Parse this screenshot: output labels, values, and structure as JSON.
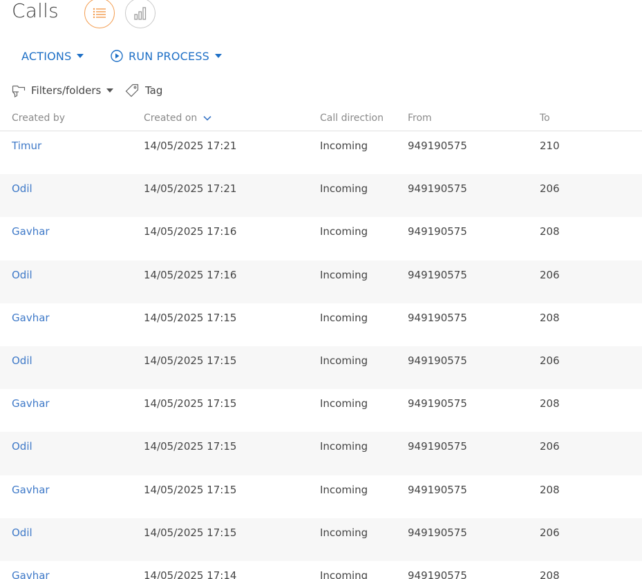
{
  "page": {
    "title": "Calls"
  },
  "colors": {
    "accent_orange": "#f39a4b",
    "link_blue": "#3e79c8",
    "action_blue": "#1d6fc6"
  },
  "view_switch": {
    "list_icon": "list-view-icon",
    "chart_icon": "bar-chart-icon"
  },
  "toolbar": {
    "actions_label": "ACTIONS",
    "run_process_label": "RUN PROCESS"
  },
  "filters": {
    "filters_label": "Filters/folders",
    "tag_label": "Tag"
  },
  "columns": {
    "created_by": "Created by",
    "created_on": "Created on",
    "call_direction": "Call direction",
    "from": "From",
    "to": "To"
  },
  "rows": [
    {
      "created_by": "Timur",
      "created_on": "14/05/2025 17:21",
      "direction": "Incoming",
      "from": "949190575",
      "to": "210"
    },
    {
      "created_by": "Odil",
      "created_on": "14/05/2025 17:21",
      "direction": "Incoming",
      "from": "949190575",
      "to": "206"
    },
    {
      "created_by": "Gavhar",
      "created_on": "14/05/2025 17:16",
      "direction": "Incoming",
      "from": "949190575",
      "to": "208"
    },
    {
      "created_by": "Odil",
      "created_on": "14/05/2025 17:16",
      "direction": "Incoming",
      "from": "949190575",
      "to": "206"
    },
    {
      "created_by": "Gavhar",
      "created_on": "14/05/2025 17:15",
      "direction": "Incoming",
      "from": "949190575",
      "to": "208"
    },
    {
      "created_by": "Odil",
      "created_on": "14/05/2025 17:15",
      "direction": "Incoming",
      "from": "949190575",
      "to": "206"
    },
    {
      "created_by": "Gavhar",
      "created_on": "14/05/2025 17:15",
      "direction": "Incoming",
      "from": "949190575",
      "to": "208"
    },
    {
      "created_by": "Odil",
      "created_on": "14/05/2025 17:15",
      "direction": "Incoming",
      "from": "949190575",
      "to": "206"
    },
    {
      "created_by": "Gavhar",
      "created_on": "14/05/2025 17:15",
      "direction": "Incoming",
      "from": "949190575",
      "to": "208"
    },
    {
      "created_by": "Odil",
      "created_on": "14/05/2025 17:15",
      "direction": "Incoming",
      "from": "949190575",
      "to": "206"
    },
    {
      "created_by": "Gavhar",
      "created_on": "14/05/2025 17:14",
      "direction": "Incoming",
      "from": "949190575",
      "to": "208"
    }
  ]
}
